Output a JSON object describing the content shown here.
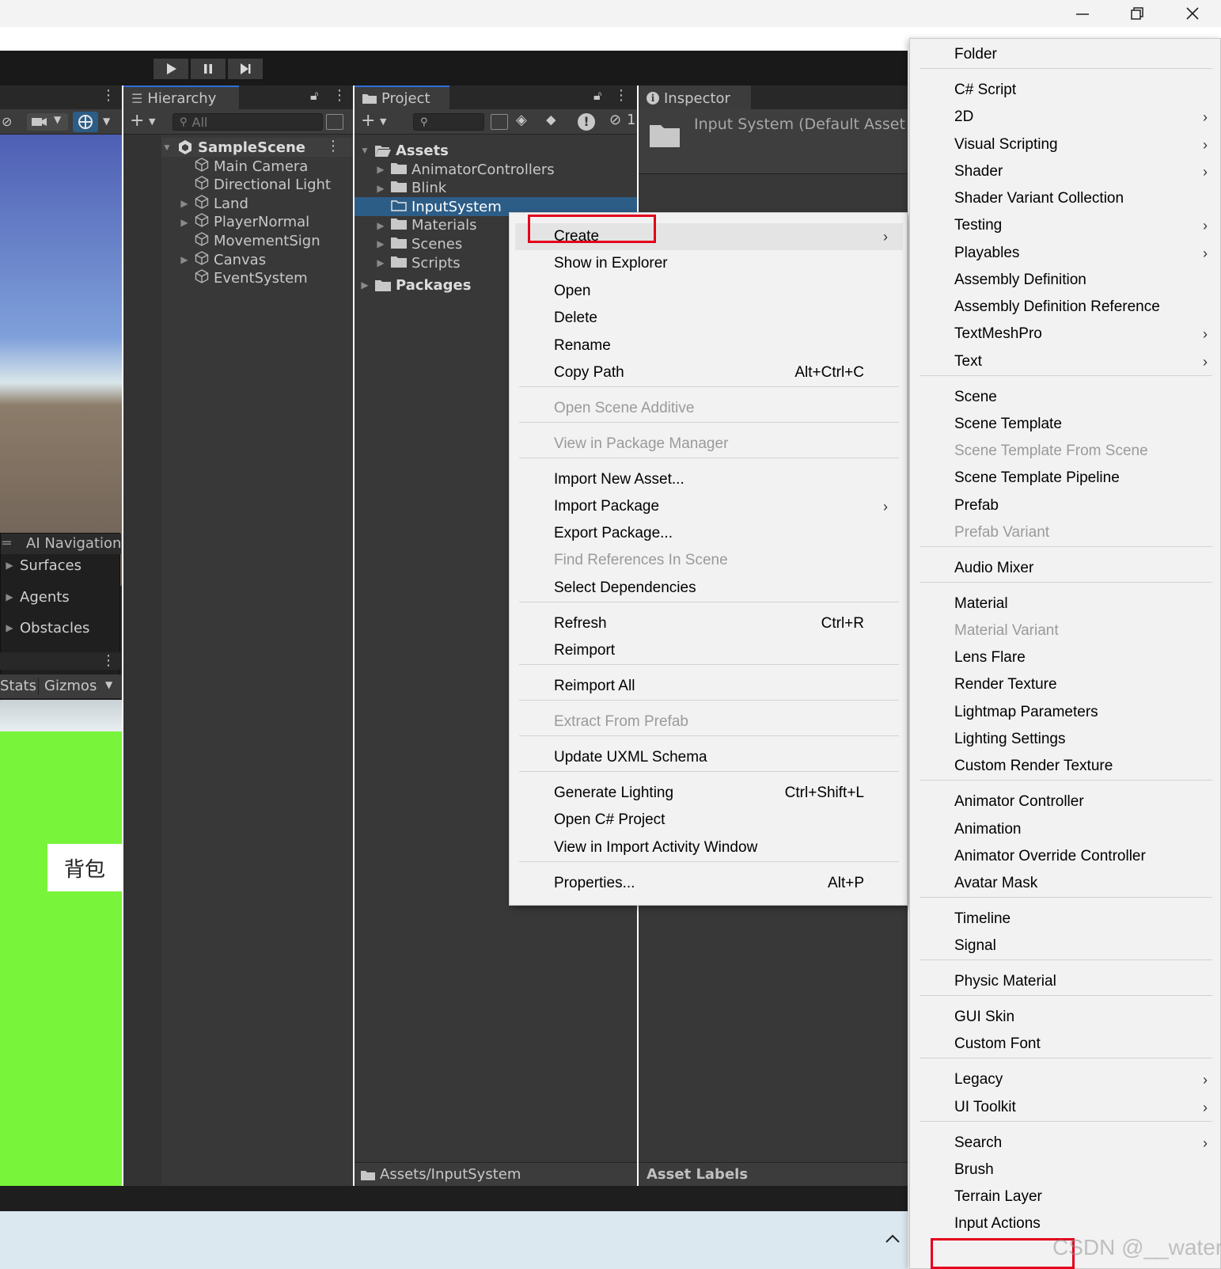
{
  "window_controls": {
    "minimize": "minimize-icon",
    "maximize": "restore-icon",
    "close": "close-icon"
  },
  "scene": {
    "ai_nav_title": "AI Navigation",
    "ai_nav_items": [
      "Surfaces",
      "Agents",
      "Obstacles"
    ],
    "game_tabs": {
      "stats": "Stats",
      "gizmos": "Gizmos"
    },
    "game_button_text": "背包"
  },
  "hierarchy": {
    "tab": "Hierarchy",
    "search_placeholder": "All",
    "scene_name": "SampleScene",
    "items": [
      {
        "name": "Main Camera",
        "expand": false
      },
      {
        "name": "Directional Light",
        "expand": false
      },
      {
        "name": "Land",
        "expand": true
      },
      {
        "name": "PlayerNormal",
        "expand": true
      },
      {
        "name": "MovementSign",
        "expand": false
      },
      {
        "name": "Canvas",
        "expand": true
      },
      {
        "name": "EventSystem",
        "expand": false
      }
    ]
  },
  "project": {
    "tab": "Project",
    "eye_count": "1",
    "root": "Assets",
    "folders": [
      "AnimatorControllers",
      "Blink",
      "InputSystem",
      "Materials",
      "Scenes",
      "Scripts"
    ],
    "selected_folder": "InputSystem",
    "packages": "Packages",
    "path": "Assets/InputSystem"
  },
  "inspector": {
    "tab": "Inspector",
    "title": "Input System (Default Asset",
    "asset_labels": "Asset Labels"
  },
  "context_menu": {
    "items": [
      {
        "label": "Create",
        "arrow": true,
        "highlight": true
      },
      {
        "label": "Show in Explorer"
      },
      {
        "label": "Open"
      },
      {
        "label": "Delete"
      },
      {
        "label": "Rename"
      },
      {
        "label": "Copy Path",
        "shortcut": "Alt+Ctrl+C"
      },
      {
        "label": "Open Scene Additive",
        "disabled": true
      },
      {
        "label": "View in Package Manager",
        "disabled": true
      },
      {
        "label": "Import New Asset..."
      },
      {
        "label": "Import Package",
        "arrow": true
      },
      {
        "label": "Export Package..."
      },
      {
        "label": "Find References In Scene",
        "disabled": true
      },
      {
        "label": "Select Dependencies"
      },
      {
        "label": "Refresh",
        "shortcut": "Ctrl+R"
      },
      {
        "label": "Reimport"
      },
      {
        "label": "Reimport All"
      },
      {
        "label": "Extract From Prefab",
        "disabled": true
      },
      {
        "label": "Update UXML Schema"
      },
      {
        "label": "Generate Lighting",
        "shortcut": "Ctrl+Shift+L"
      },
      {
        "label": "Open C# Project"
      },
      {
        "label": "View in Import Activity Window"
      },
      {
        "label": "Properties...",
        "shortcut": "Alt+P"
      }
    ]
  },
  "create_submenu": {
    "items": [
      {
        "label": "Folder"
      },
      {
        "label": "C# Script"
      },
      {
        "label": "2D",
        "arrow": true
      },
      {
        "label": "Visual Scripting",
        "arrow": true
      },
      {
        "label": "Shader",
        "arrow": true
      },
      {
        "label": "Shader Variant Collection"
      },
      {
        "label": "Testing",
        "arrow": true
      },
      {
        "label": "Playables",
        "arrow": true
      },
      {
        "label": "Assembly Definition"
      },
      {
        "label": "Assembly Definition Reference"
      },
      {
        "label": "TextMeshPro",
        "arrow": true
      },
      {
        "label": "Text",
        "arrow": true
      },
      {
        "label": "Scene"
      },
      {
        "label": "Scene Template"
      },
      {
        "label": "Scene Template From Scene",
        "disabled": true
      },
      {
        "label": "Scene Template Pipeline"
      },
      {
        "label": "Prefab"
      },
      {
        "label": "Prefab Variant",
        "disabled": true
      },
      {
        "label": "Audio Mixer"
      },
      {
        "label": "Material"
      },
      {
        "label": "Material Variant",
        "disabled": true
      },
      {
        "label": "Lens Flare"
      },
      {
        "label": "Render Texture"
      },
      {
        "label": "Lightmap Parameters"
      },
      {
        "label": "Lighting Settings"
      },
      {
        "label": "Custom Render Texture"
      },
      {
        "label": "Animator Controller"
      },
      {
        "label": "Animation"
      },
      {
        "label": "Animator Override Controller"
      },
      {
        "label": "Avatar Mask"
      },
      {
        "label": "Timeline"
      },
      {
        "label": "Signal"
      },
      {
        "label": "Physic Material"
      },
      {
        "label": "GUI Skin"
      },
      {
        "label": "Custom Font"
      },
      {
        "label": "Legacy",
        "arrow": true
      },
      {
        "label": "UI Toolkit",
        "arrow": true
      },
      {
        "label": "Search",
        "arrow": true
      },
      {
        "label": "Brush"
      },
      {
        "label": "Terrain Layer"
      },
      {
        "label": "Input Actions",
        "highlight": true
      }
    ]
  },
  "watermark": "CSDN @__water",
  "colors": {
    "highlight_box": "#e3001b",
    "selection": "#2c5d87",
    "game_green": "#78f53a"
  }
}
